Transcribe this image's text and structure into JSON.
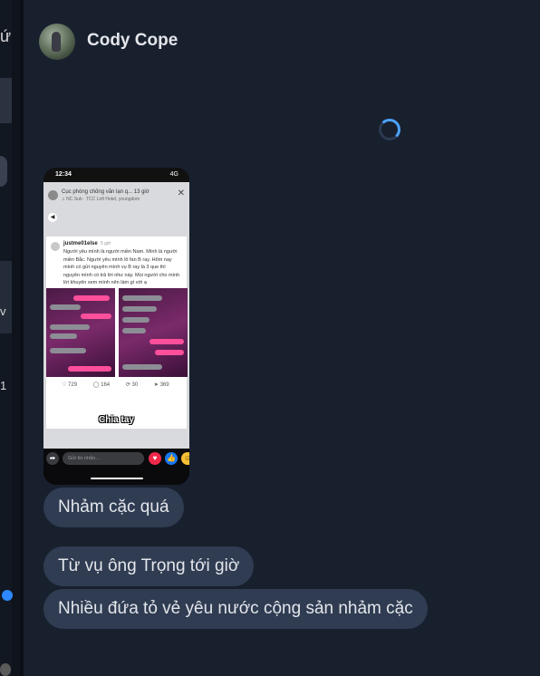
{
  "left_strip": {
    "glyph_top": "ứ",
    "glyph_v": "v",
    "glyph_1": "1"
  },
  "conversation": {
    "contact_name": "Cody Cope"
  },
  "shared_media": {
    "time": "12:34",
    "signal": "4G",
    "story_header": "Cục phòng chống văn lạn q...",
    "story_time": "13 giờ",
    "story_sub": "♫ NC Sub · TCC Loft Hotel, youngdom",
    "post_user": "justme01else",
    "post_time": "5 giờ",
    "post_text": "Người yêu mình là người miền Nam. Mình là người miền Bắc. Người yêu mình lô fan B ray. Hôm nay mình có gửi nguyên mình vụ B ray là 3 que thì nguyên mình có trả lời như này. Mọi người cho mình lời khuyên xem mình nên làm gì với ạ",
    "reactions": {
      "likes": "729",
      "comments": "164",
      "reposts": "30",
      "shares": "369"
    },
    "caption": "Chia tay",
    "reply_placeholder": "Gửi tin nhắn..."
  },
  "messages": [
    {
      "text": "Nhảm cặc quá"
    },
    {
      "text": "Từ vụ ông Trọng tới giờ"
    },
    {
      "text": "Nhiều đứa tỏ vẻ yêu nước cộng sản nhảm cặc"
    }
  ],
  "colors": {
    "background": "#18202e",
    "bubble": "#2f3c52",
    "spinner": "#4aa3ff",
    "accent_dot": "#2d88ff"
  }
}
